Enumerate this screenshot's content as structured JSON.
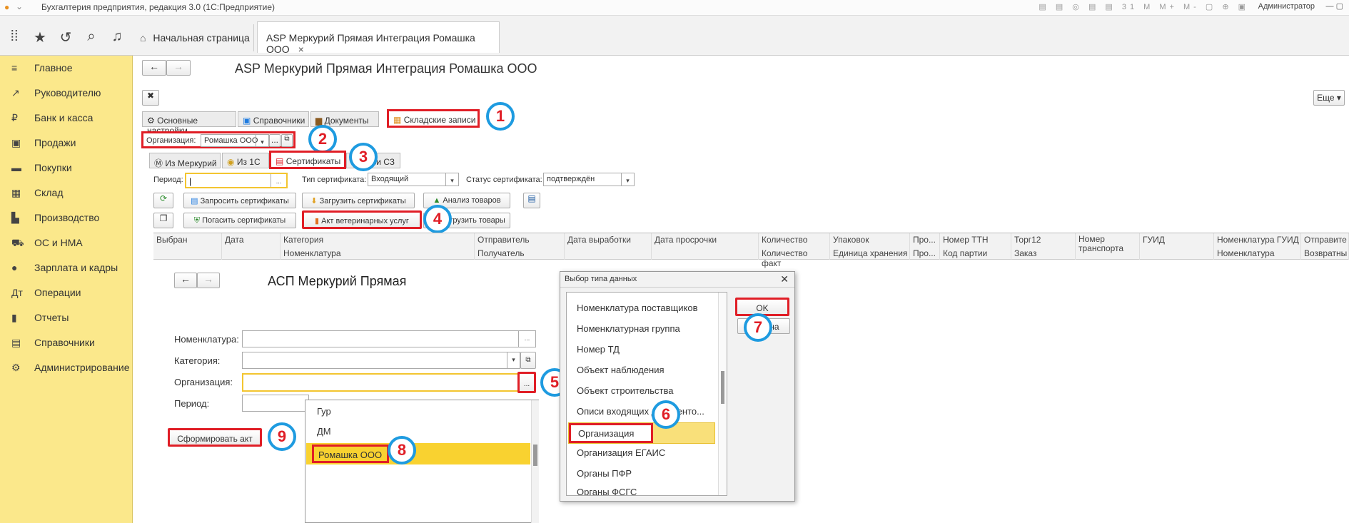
{
  "window": {
    "title": "Бухгалтерия предприятия, редакция 3.0  (1С:Предприятие)",
    "user": "Администратор",
    "toolbar_icons": "▤ ▤ ◎ ▤ ▤ 31 M M+ M- ▢ ⊕ ▣"
  },
  "tabs": {
    "home": "Начальная страница",
    "active": "ASP Меркурий Прямая Интеграция Ромашка ООО",
    "close": "×"
  },
  "sidebar": {
    "items": [
      {
        "icon": "≡",
        "label": "Главное"
      },
      {
        "icon": "↗",
        "label": "Руководителю"
      },
      {
        "icon": "₽",
        "label": "Банк и касса"
      },
      {
        "icon": "▣",
        "label": "Продажи"
      },
      {
        "icon": "▬",
        "label": "Покупки"
      },
      {
        "icon": "▦",
        "label": "Склад"
      },
      {
        "icon": "▙",
        "label": "Производство"
      },
      {
        "icon": "⛟",
        "label": "ОС и НМА"
      },
      {
        "icon": "●",
        "label": "Зарплата и кадры"
      },
      {
        "icon": "Дт",
        "label": "Операции"
      },
      {
        "icon": "▮",
        "label": "Отчеты"
      },
      {
        "icon": "▤",
        "label": "Справочники"
      },
      {
        "icon": "⚙",
        "label": "Администрирование"
      }
    ]
  },
  "page": {
    "title": "ASP Меркурий Прямая Интеграция Ромашка ООО",
    "more": "Еще ▾"
  },
  "main_tabs": [
    "Основные настройки",
    "Справочники",
    "Документы",
    "Складские записи"
  ],
  "org": {
    "label": "Организация:",
    "value": "Ромашка ООО",
    "btn": "..."
  },
  "sub_tabs": [
    "Из Меркурий",
    "Из 1С",
    "Сертификаты",
    "писи СЗ"
  ],
  "filters": {
    "period_label": "Период:",
    "type_label": "Тип сертификата:",
    "type_value": "Входящий",
    "status_label": "Статус сертификата:",
    "status_value": "подтверждён"
  },
  "buttons": {
    "request": "Запросить сертификаты",
    "load": "Загрузить сертификаты",
    "analysis": "Анализ товаров",
    "repay": "Погасить сертификаты",
    "act": "Акт ветеринарных услуг",
    "unload": "ргрузить товары"
  },
  "grid": {
    "row1": [
      "Выбран",
      "Дата",
      "Категория",
      "Отправитель",
      "Дата выработки",
      "Дата просрочки",
      "Количество",
      "Упаковок",
      "Про...",
      "Номер ТТН",
      "Торг12",
      "Номер транспорта",
      "ГУИД",
      "Номенклатура ГУИД",
      "Отправите"
    ],
    "row2": [
      "Номенклатура",
      "Получатель",
      "Количество факт",
      "Единица хранения",
      "Про...",
      "Код партии",
      "Заказ",
      "Номенклатура",
      "Возвратны"
    ]
  },
  "form": {
    "title": "АСП Меркурий Прямая",
    "nom": "Номенклатура:",
    "cat": "Категория:",
    "org": "Организация:",
    "period": "Период:",
    "generate": "Сформировать акт"
  },
  "dropdown": {
    "items": [
      "Гур",
      "ДМ",
      "Ромашка ООО"
    ]
  },
  "dialog": {
    "title": "Выбор типа данных",
    "items": [
      "Номенклатура поставщиков",
      "Номенклатурная группа",
      "Номер ТД",
      "Объект наблюдения",
      "Объект строительства",
      "Описи входящих документо...",
      "Организация",
      "Организация ЕГАИС",
      "Органы ПФР",
      "Органы ФСГС"
    ],
    "ok": "OK",
    "cancel": "Отмена"
  },
  "markers": [
    "1",
    "2",
    "3",
    "4",
    "5",
    "6",
    "7",
    "8",
    "9"
  ],
  "colors": {
    "sidebar": "#fbe88b",
    "highlight": "#f9d230",
    "marker_border": "#1e9be0",
    "marker_text": "#e01e26"
  }
}
